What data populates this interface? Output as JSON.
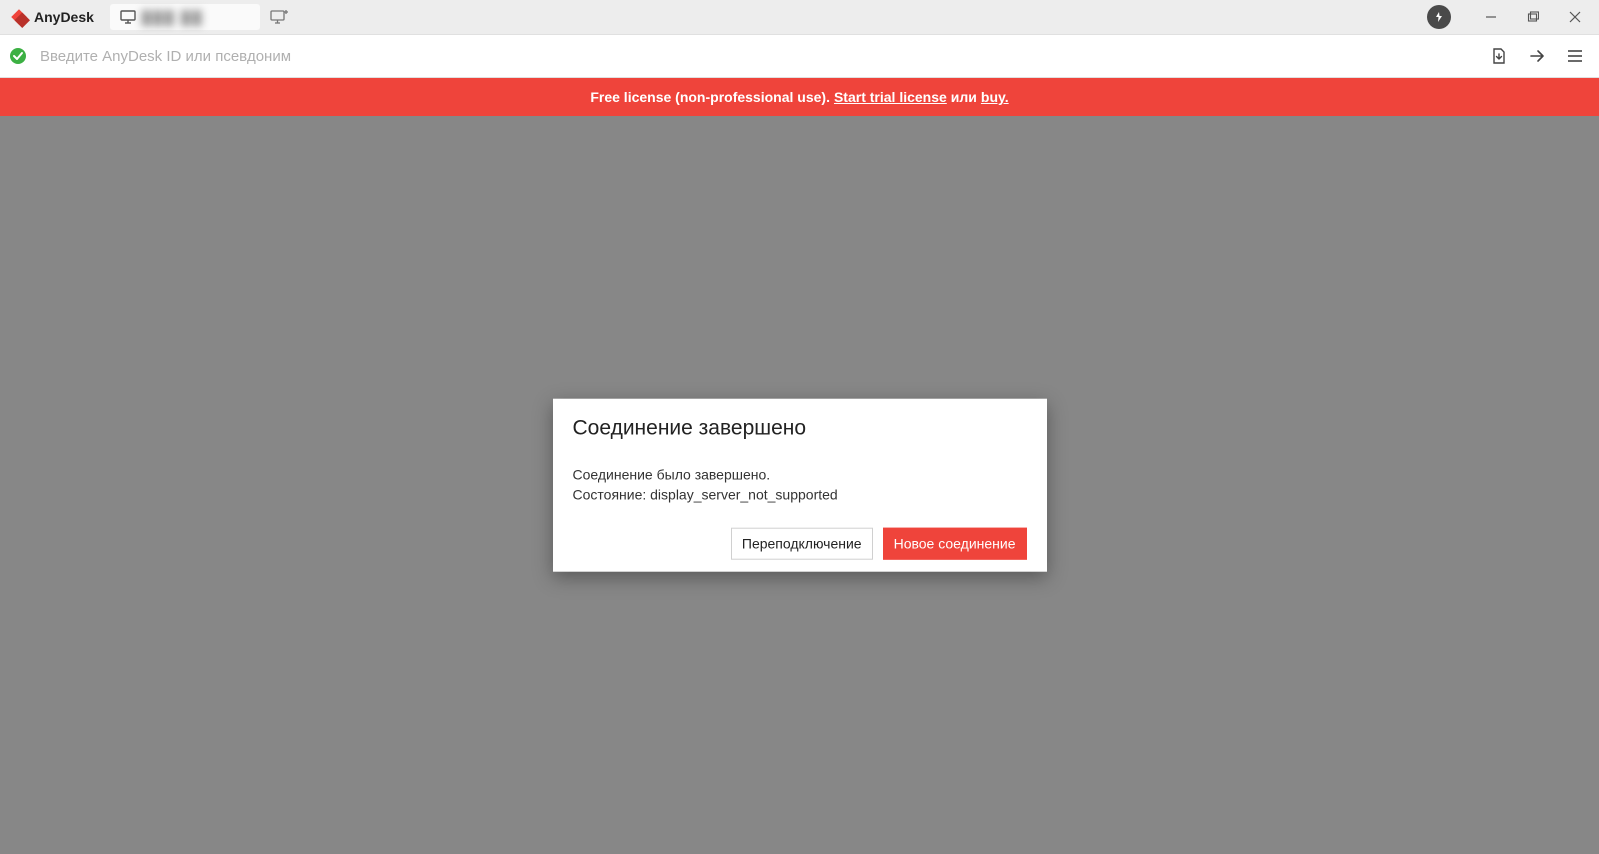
{
  "app": {
    "name": "AnyDesk"
  },
  "titlebar": {
    "tab_placeholder": "███ ██"
  },
  "address_bar": {
    "placeholder": "Введите AnyDesk ID или псевдоним",
    "value": ""
  },
  "license_banner": {
    "text_prefix": "Free license (non-professional use). ",
    "link_trial": "Start trial license",
    "text_middle": " или ",
    "link_buy": "buy."
  },
  "dialog": {
    "title": "Соединение завершено",
    "line1": "Соединение было завершено.",
    "line2": "Состояние: display_server_not_supported",
    "btn_reconnect": "Переподключение",
    "btn_new_connection": "Новое соединение"
  },
  "colors": {
    "accent": "#ef443b"
  }
}
